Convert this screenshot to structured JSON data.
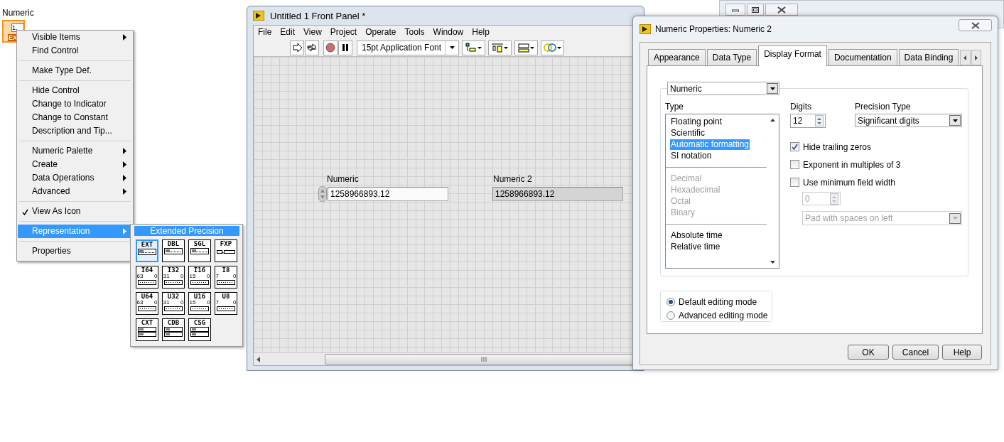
{
  "desktop_control": {
    "label": "Numeric",
    "value": "1.",
    "badge": "EX",
    "selected": true
  },
  "context_menu": {
    "sections": [
      [
        {
          "label": "Visible Items",
          "submenu": true,
          "checked": false,
          "selected": false
        },
        {
          "label": "Find Control",
          "submenu": false,
          "checked": false,
          "selected": false
        }
      ],
      [
        {
          "label": "Make Type Def.",
          "submenu": false,
          "checked": false,
          "selected": false
        }
      ],
      [
        {
          "label": "Hide Control",
          "submenu": false,
          "checked": false,
          "selected": false
        },
        {
          "label": "Change to Indicator",
          "submenu": false,
          "checked": false,
          "selected": false
        },
        {
          "label": "Change to Constant",
          "submenu": false,
          "checked": false,
          "selected": false
        },
        {
          "label": "Description and Tip...",
          "submenu": false,
          "checked": false,
          "selected": false
        }
      ],
      [
        {
          "label": "Numeric Palette",
          "submenu": true,
          "checked": false,
          "selected": false
        },
        {
          "label": "Create",
          "submenu": true,
          "checked": false,
          "selected": false
        },
        {
          "label": "Data Operations",
          "submenu": true,
          "checked": false,
          "selected": false
        },
        {
          "label": "Advanced",
          "submenu": true,
          "checked": false,
          "selected": false
        }
      ],
      [
        {
          "label": "View As Icon",
          "submenu": false,
          "checked": true,
          "selected": false
        }
      ],
      [
        {
          "label": "Representation",
          "submenu": true,
          "checked": false,
          "selected": true
        }
      ],
      [
        {
          "label": "Properties",
          "submenu": false,
          "checked": false,
          "selected": false
        }
      ]
    ]
  },
  "representation_menu": {
    "title": "Extended Precision",
    "types": [
      {
        "label": "EXT",
        "kind": "float",
        "selected": true
      },
      {
        "label": "DBL",
        "kind": "float",
        "selected": false
      },
      {
        "label": "SGL",
        "kind": "float",
        "selected": false
      },
      {
        "label": "FXP",
        "kind": "fixed",
        "selected": false
      },
      {
        "label": "I64",
        "kind": "integer",
        "high_bit": "63",
        "low_bit": "0",
        "selected": false
      },
      {
        "label": "I32",
        "kind": "integer",
        "high_bit": "31",
        "low_bit": "0",
        "selected": false
      },
      {
        "label": "I16",
        "kind": "integer",
        "high_bit": "15",
        "low_bit": "0",
        "selected": false
      },
      {
        "label": "I8",
        "kind": "integer",
        "high_bit": "7",
        "low_bit": "0",
        "selected": false
      },
      {
        "label": "U64",
        "kind": "integer",
        "high_bit": "63",
        "low_bit": "0",
        "selected": false
      },
      {
        "label": "U32",
        "kind": "integer",
        "high_bit": "31",
        "low_bit": "0",
        "selected": false
      },
      {
        "label": "U16",
        "kind": "integer",
        "high_bit": "15",
        "low_bit": "0",
        "selected": false
      },
      {
        "label": "U8",
        "kind": "integer",
        "high_bit": "7",
        "low_bit": "0",
        "selected": false
      },
      {
        "label": "CXT",
        "kind": "complex",
        "selected": false
      },
      {
        "label": "CDB",
        "kind": "complex",
        "selected": false
      },
      {
        "label": "CSG",
        "kind": "complex",
        "selected": false
      }
    ]
  },
  "front_panel": {
    "title": "Untitled 1 Front Panel *",
    "menu": [
      "File",
      "Edit",
      "View",
      "Project",
      "Operate",
      "Tools",
      "Window",
      "Help"
    ],
    "font": "15pt Application Font",
    "controls": [
      {
        "kind": "control",
        "label": "Numeric",
        "value": "1258966893.12"
      },
      {
        "kind": "indicator",
        "label": "Numeric 2",
        "value": "1258966893.12"
      }
    ]
  },
  "dialog": {
    "title": "Numeric Properties: Numeric 2",
    "tabs": [
      {
        "label": "Appearance",
        "selected": false
      },
      {
        "label": "Data Type",
        "selected": false
      },
      {
        "label": "Display Format",
        "selected": true
      },
      {
        "label": "Documentation",
        "selected": false
      },
      {
        "label": "Data Binding",
        "selected": false
      }
    ],
    "format": "Numeric",
    "type_label": "Type",
    "types": [
      {
        "kind": "item",
        "label": "Floating point",
        "selected": false,
        "disabled": false
      },
      {
        "kind": "item",
        "label": "Scientific",
        "selected": false,
        "disabled": false
      },
      {
        "kind": "item",
        "label": "Automatic formatting",
        "selected": true,
        "disabled": false
      },
      {
        "kind": "item",
        "label": "SI notation",
        "selected": false,
        "disabled": false
      },
      {
        "kind": "separator"
      },
      {
        "kind": "item",
        "label": "Decimal",
        "selected": false,
        "disabled": true
      },
      {
        "kind": "item",
        "label": "Hexadecimal",
        "selected": false,
        "disabled": true
      },
      {
        "kind": "item",
        "label": "Octal",
        "selected": false,
        "disabled": true
      },
      {
        "kind": "item",
        "label": "Binary",
        "selected": false,
        "disabled": true
      },
      {
        "kind": "separator"
      },
      {
        "kind": "item",
        "label": "Absolute time",
        "selected": false,
        "disabled": false
      },
      {
        "kind": "item",
        "label": "Relative time",
        "selected": false,
        "disabled": false
      }
    ],
    "digits": {
      "label": "Digits",
      "value": "12"
    },
    "precision_type": {
      "label": "Precision Type",
      "value": "Significant digits"
    },
    "options": [
      {
        "label": "Hide trailing zeros",
        "checked": true
      },
      {
        "label": "Exponent in multiples of 3",
        "checked": false
      },
      {
        "label": "Use minimum field width",
        "checked": false
      }
    ],
    "min_width": {
      "value": "0",
      "disabled": true
    },
    "padding": {
      "value": "Pad with spaces on left",
      "disabled": true
    },
    "editing_modes": [
      {
        "label": "Default editing mode",
        "selected": true
      },
      {
        "label": "Advanced editing mode",
        "selected": false
      }
    ],
    "buttons": [
      "OK",
      "Cancel",
      "Help"
    ]
  }
}
